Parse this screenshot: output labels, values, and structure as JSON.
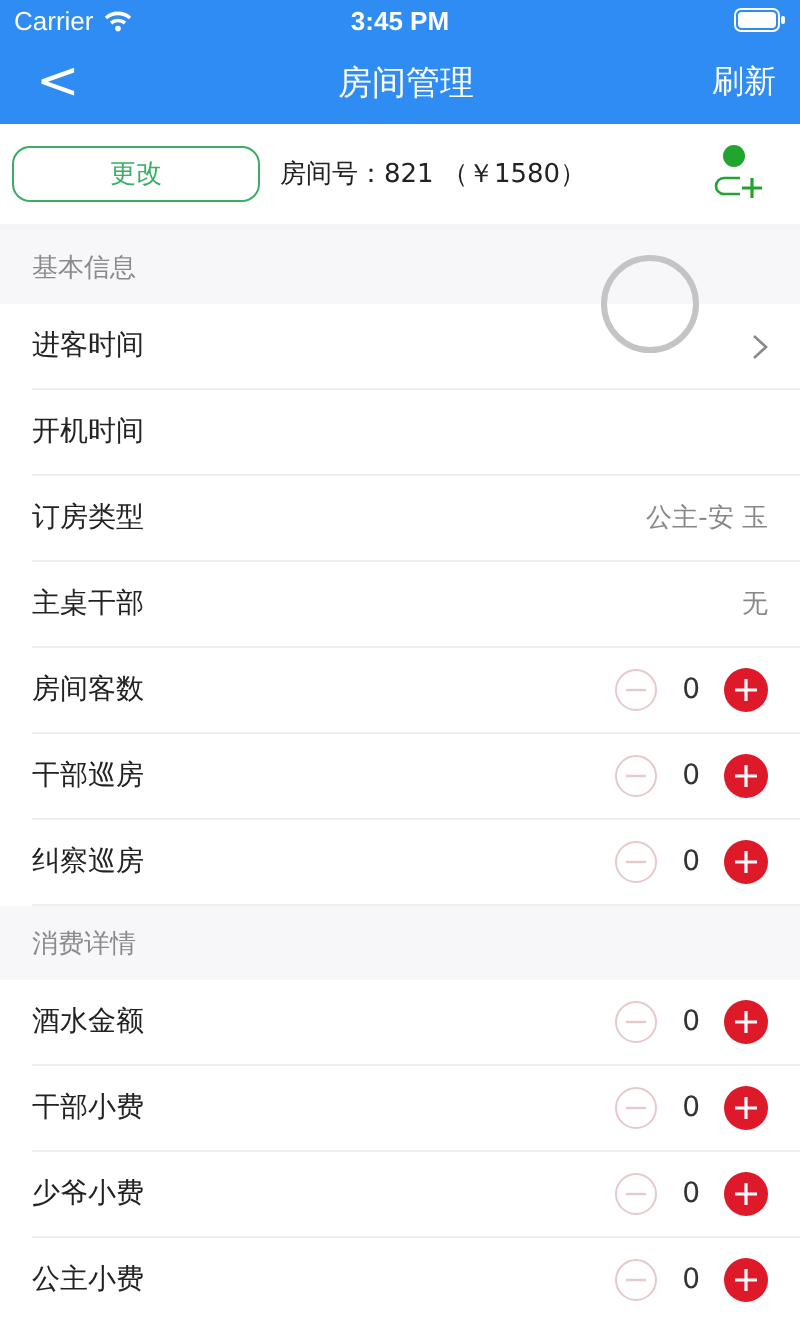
{
  "status_bar": {
    "carrier": "Carrier",
    "time": "3:45 PM"
  },
  "nav_bar": {
    "back": "<",
    "title": "房间管理",
    "action": "刷新"
  },
  "room_bar": {
    "button": "更改",
    "room": "房间号：821 （￥1580）"
  },
  "loading": true,
  "sections": [
    {
      "title": "基本信息",
      "rows": [
        {
          "kind": "link",
          "label": "进客时间"
        },
        {
          "kind": "plain",
          "label": "开机时间"
        },
        {
          "kind": "value",
          "label": "订房类型",
          "value": "公主-安 玉"
        },
        {
          "kind": "value",
          "label": "主桌干部",
          "value": "无"
        },
        {
          "kind": "counter",
          "label": "房间客数",
          "value": "0"
        },
        {
          "kind": "counter",
          "label": "干部巡房",
          "value": "0"
        },
        {
          "kind": "counter",
          "label": "纠察巡房",
          "value": "0"
        }
      ]
    },
    {
      "title": "消费详情",
      "rows": [
        {
          "kind": "counter",
          "label": "酒水金额",
          "value": "0"
        },
        {
          "kind": "counter",
          "label": "干部小费",
          "value": "0"
        },
        {
          "kind": "counter",
          "label": "少爷小费",
          "value": "0"
        },
        {
          "kind": "counter",
          "label": "公主小费",
          "value": "0"
        }
      ]
    }
  ]
}
